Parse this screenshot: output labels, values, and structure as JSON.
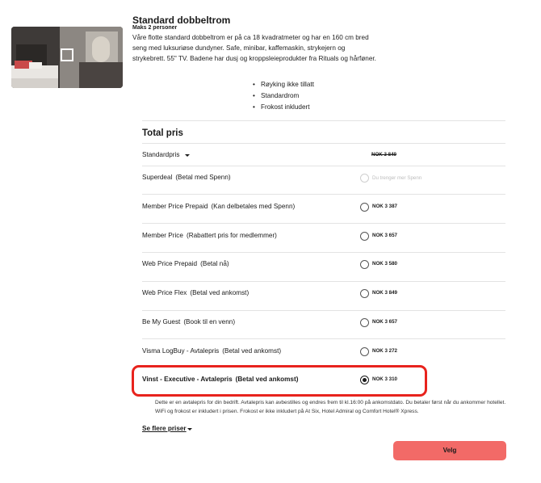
{
  "room": {
    "title": "Standard dobbeltrom",
    "capacity": "Maks 2 personer",
    "description": "Våre flotte standard dobbeltrom er på ca 18 kvadratmeter og har en 160 cm bred seng med luksuriøse dundyner. Safe, minibar, kaffemaskin, strykejern og strykebrett. 55\" TV. Badene har dusj og kroppsleieprodukter fra Rituals og hårføner.",
    "features": [
      "Røyking ikke tillatt",
      "Standardrom",
      "Frokost inkludert"
    ]
  },
  "pricing": {
    "title": "Total pris",
    "standard_label": "Standardpris",
    "standard_price": "NOK 3 849",
    "rates": [
      {
        "name": "Superdeal",
        "note": "(Betal med Spenn)",
        "price": "Du trenger mer Spenn",
        "state": "disabled"
      },
      {
        "name": "Member Price Prepaid",
        "note": "(Kan delbetales med Spenn)",
        "price": "NOK 3 387",
        "state": "enabled"
      },
      {
        "name": "Member Price",
        "note": "(Rabattert pris for medlemmer)",
        "price": "NOK 3 657",
        "state": "enabled"
      },
      {
        "name": "Web Price Prepaid",
        "note": "(Betal nå)",
        "price": "NOK 3 580",
        "state": "enabled"
      },
      {
        "name": "Web Price Flex",
        "note": "(Betal ved ankomst)",
        "price": "NOK 3 849",
        "state": "enabled"
      },
      {
        "name": "Be My Guest",
        "note": "(Book til en venn)",
        "price": "NOK 3 657",
        "state": "enabled"
      },
      {
        "name": "Visma LogBuy - Avtalepris",
        "note": "(Betal ved ankomst)",
        "price": "NOK 3 272",
        "state": "enabled"
      },
      {
        "name": "Vinst - Executive - Avtalepris",
        "note": "(Betal ved ankomst)",
        "price": "NOK 3 310",
        "state": "selected"
      }
    ],
    "selected_info": "Dette er en avtalepris for din bedrift. Avtalepris kan avbestilles og endres frem til kl.16:00 på ankomstdato. Du betaler først når du ankommer hotellet. WiFi og frokost er inkludert i prisen. Frokost er ikke inkludert på At Six, Hotel Admiral og Comfort Hotel® Xpress.",
    "more_prices_label": "Se flere priser",
    "select_button_label": "Velg"
  },
  "colors": {
    "highlight": "#e8231d",
    "select_button": "#f26a67"
  }
}
